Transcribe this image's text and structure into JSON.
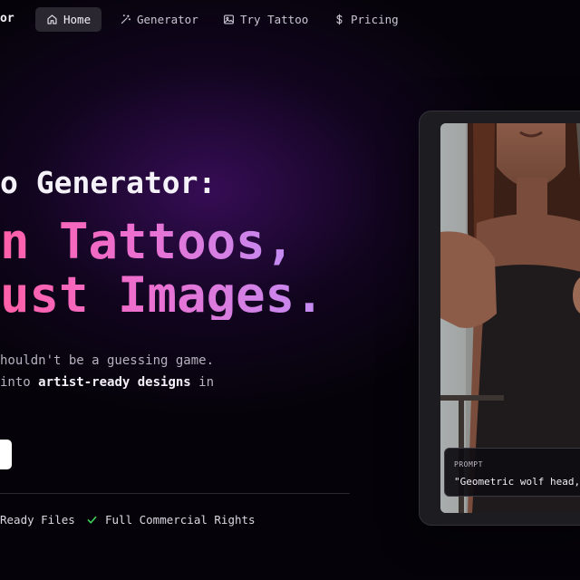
{
  "nav": {
    "brand_tail": "or",
    "items": [
      {
        "label": "Home",
        "icon": "home-icon"
      },
      {
        "label": "Generator",
        "icon": "magic-wand-icon"
      },
      {
        "label": "Try Tattoo",
        "icon": "image-icon"
      },
      {
        "label": "Pricing",
        "icon": "dollar-icon"
      }
    ],
    "active_index": 0
  },
  "hero": {
    "headline": "o Generator:",
    "big_line_1": "n Tattoos,",
    "big_line_2": "ust Images.",
    "desc_line_1": "houldn't be a guessing game.",
    "desc_line_2_pre": "into ",
    "desc_line_2_bold": "artist-ready designs",
    "desc_line_2_post": " in"
  },
  "features": [
    {
      "label": "Ready Files"
    },
    {
      "label": "Full Commercial Rights",
      "icon": "check-icon"
    }
  ],
  "preview": {
    "prompt_label": "PROMPT",
    "prompt_text": "\"Geometric wolf head,"
  },
  "colors": {
    "accent_pink": "#ff5fa8",
    "accent_purple": "#c28cf4",
    "check_green": "#3ecf5a",
    "nav_active_bg": "#2a2730"
  }
}
